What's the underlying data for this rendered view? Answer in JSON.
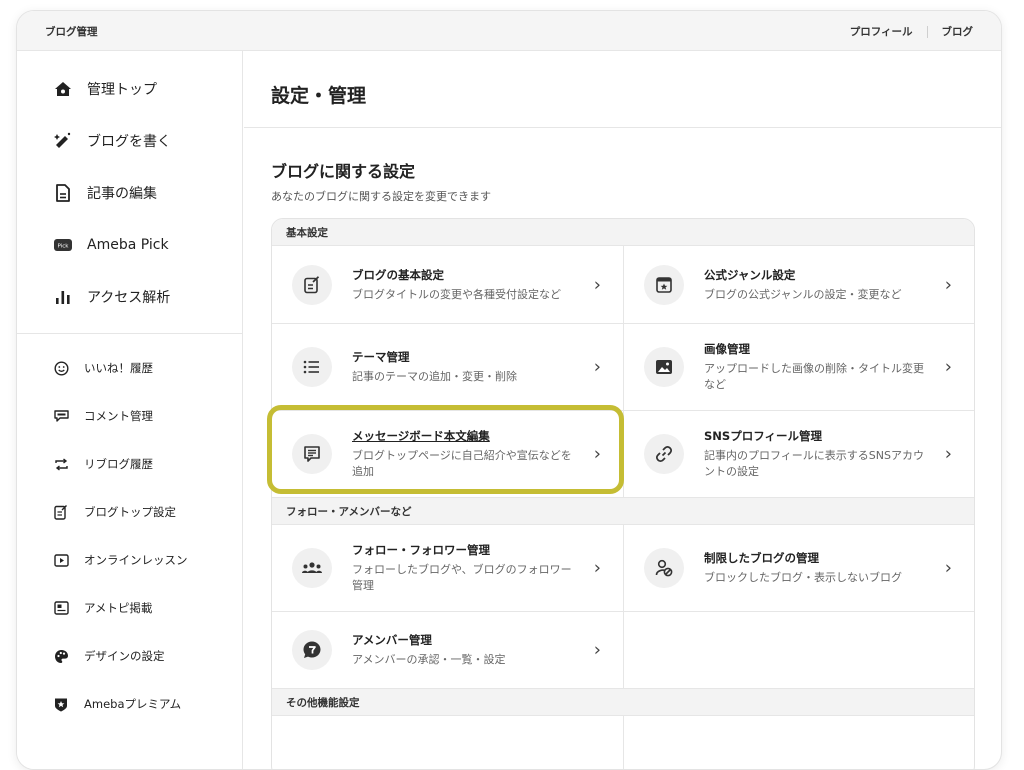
{
  "topbar": {
    "brand": "ブログ管理",
    "links": [
      "プロフィール",
      "ブログ"
    ]
  },
  "sidebar": {
    "main_items": [
      {
        "label": "管理トップ",
        "icon": "home-icon"
      },
      {
        "label": "ブログを書く",
        "icon": "magic-pen-icon"
      },
      {
        "label": "記事の編集",
        "icon": "document-icon"
      },
      {
        "label": "Ameba Pick",
        "icon": "pick-badge-icon"
      },
      {
        "label": "アクセス解析",
        "icon": "bar-chart-icon"
      }
    ],
    "sub_items": [
      {
        "label": "いいね！履歴",
        "icon": "smile-icon"
      },
      {
        "label": "コメント管理",
        "icon": "comment-icon"
      },
      {
        "label": "リブログ履歴",
        "icon": "reblog-icon"
      },
      {
        "label": "ブログトップ設定",
        "icon": "edit-doc-icon"
      },
      {
        "label": "オンラインレッスン",
        "icon": "video-icon"
      },
      {
        "label": "アメトピ掲載",
        "icon": "newspaper-icon"
      },
      {
        "label": "デザインの設定",
        "icon": "palette-icon"
      },
      {
        "label": "Amebaプレミアム",
        "icon": "premium-shield-icon"
      }
    ]
  },
  "main": {
    "page_title": "設定・管理",
    "section_title": "ブログに関する設定",
    "section_desc": "あなたのブログに関する設定を変更できます",
    "groups": [
      {
        "label": "基本設定"
      },
      {
        "label": "フォロー・アメンバーなど"
      },
      {
        "label": "その他機能設定"
      }
    ],
    "cards": {
      "basic": {
        "title": "ブログの基本設定",
        "desc": "ブログタイトルの変更や各種受付設定など"
      },
      "genre": {
        "title": "公式ジャンル設定",
        "desc": "ブログの公式ジャンルの設定・変更など"
      },
      "theme": {
        "title": "テーマ管理",
        "desc": "記事のテーマの追加・変更・削除"
      },
      "image": {
        "title": "画像管理",
        "desc": "アップロードした画像の削除・タイトル変更など"
      },
      "message": {
        "title": "メッセージボード本文編集",
        "desc": "ブログトップページに自己紹介や宣伝などを追加"
      },
      "sns": {
        "title": "SNSプロフィール管理",
        "desc": "記事内のプロフィールに表示するSNSアカウントの設定"
      },
      "follow": {
        "title": "フォロー・フォロワー管理",
        "desc": "フォローしたブログや、ブログのフォロワー管理"
      },
      "block": {
        "title": "制限したブログの管理",
        "desc": "ブロックしたブログ・表示しないブログ"
      },
      "amember": {
        "title": "アメンバー管理",
        "desc": "アメンバーの承認・一覧・設定"
      }
    },
    "chevron": "›",
    "highlight_color": "#c5bd34"
  }
}
